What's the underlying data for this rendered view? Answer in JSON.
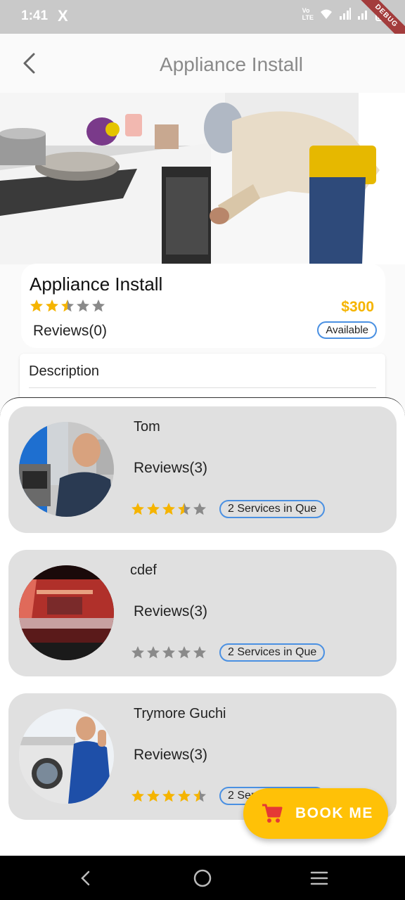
{
  "status_bar": {
    "time": "1:41",
    "app_icon": "X",
    "network": "VoLTE",
    "debug_label": "DEBUG"
  },
  "app_bar": {
    "title": "Appliance Install",
    "back_icon": "chevron-left-icon"
  },
  "service": {
    "title": "Appliance Install",
    "rating": 2.5,
    "price": "$300",
    "reviews": "Reviews(0)",
    "availability": "Available",
    "description_label": "Description"
  },
  "providers": [
    {
      "name": "Tom",
      "reviews": "Reviews(3)",
      "rating": 3.5,
      "queue": "2 Services in Que"
    },
    {
      "name": "cdef",
      "reviews": "Reviews(3)",
      "rating": 0,
      "queue": "2 Services in Que"
    },
    {
      "name": "Trymore Guchi",
      "reviews": "Reviews(3)",
      "rating": 4.5,
      "queue": "2 Services in Que"
    }
  ],
  "fab": {
    "label": "BOOK ME",
    "icon": "cart-icon"
  },
  "colors": {
    "accent": "#ffc107",
    "price": "#f5b400",
    "star_on": "#f5b400",
    "star_off": "#8a8a8a",
    "badge_border": "#4a90e2"
  }
}
